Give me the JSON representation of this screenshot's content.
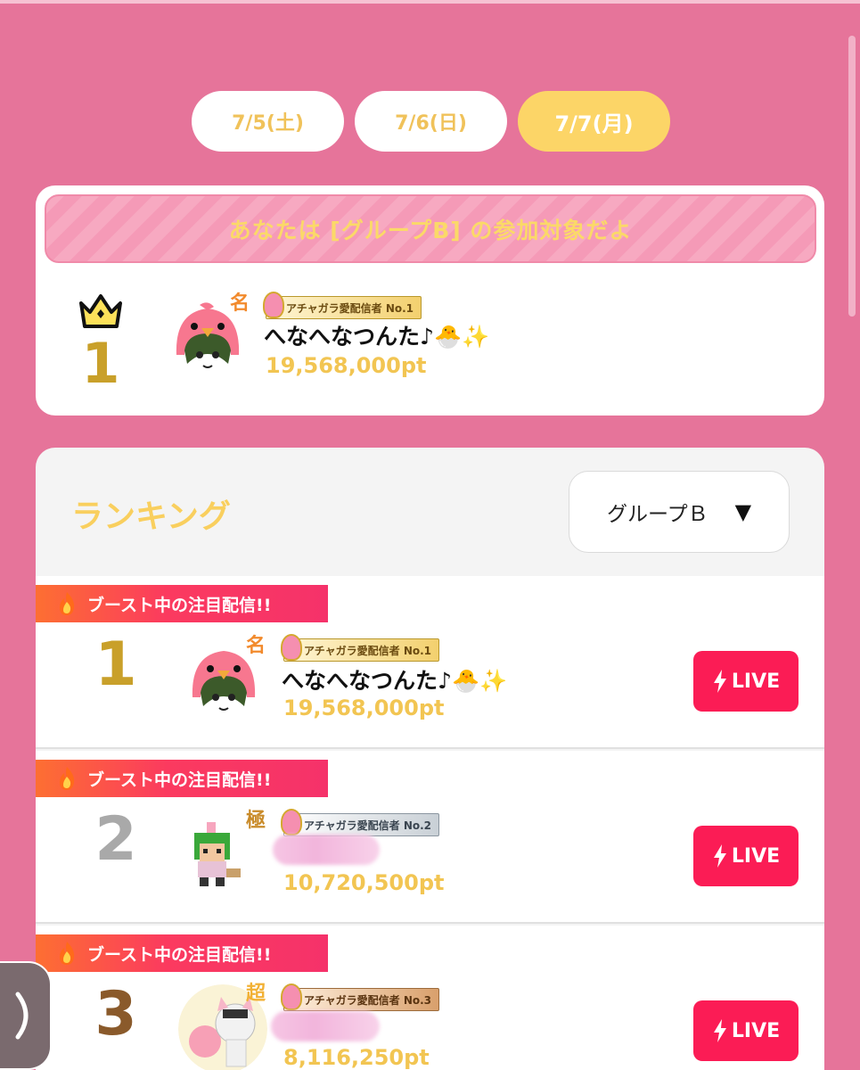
{
  "date_tabs": [
    {
      "label": "7/5(土)"
    },
    {
      "label": "7/6(日)"
    },
    {
      "label": "7/7(月)",
      "active": true
    }
  ],
  "my_card": {
    "banner": "あなたは [グループB] の参加対象だよ",
    "rank": "1",
    "avatar_tag": "名",
    "badge": "アチャガラ愛配信者 No.1",
    "name": "へなへなつんた♪🐣✨",
    "points": "19,568,000pt"
  },
  "ranking": {
    "title": "ランキング",
    "group_select": {
      "value": "グループＢ",
      "arrow": "▼"
    },
    "boost_label": "ブースト中の注目配信!!",
    "live_label": "LIVE",
    "rows": [
      {
        "rank": "1",
        "avatar_tag": "名",
        "badge": "アチャガラ愛配信者 No.1",
        "name": "へなへなつんた♪🐣✨",
        "points": "19,568,000pt"
      },
      {
        "rank": "2",
        "avatar_tag": "極",
        "badge": "アチャガラ愛配信者 No.2",
        "name": "",
        "points": "10,720,500pt"
      },
      {
        "rank": "3",
        "avatar_tag": "超",
        "badge": "アチャガラ愛配信者 No.3",
        "name": "",
        "points": "8,116,250pt"
      }
    ]
  },
  "colors": {
    "background": "#e6749a",
    "gold": "#f2c552",
    "live": "#fb1c55",
    "rank1": "#c9a02a",
    "rank2": "#a9a9a9",
    "rank3": "#8a5a2b"
  },
  "icons": [
    "crown-icon",
    "flame-icon",
    "lightning-icon",
    "chevron-right-icon"
  ]
}
